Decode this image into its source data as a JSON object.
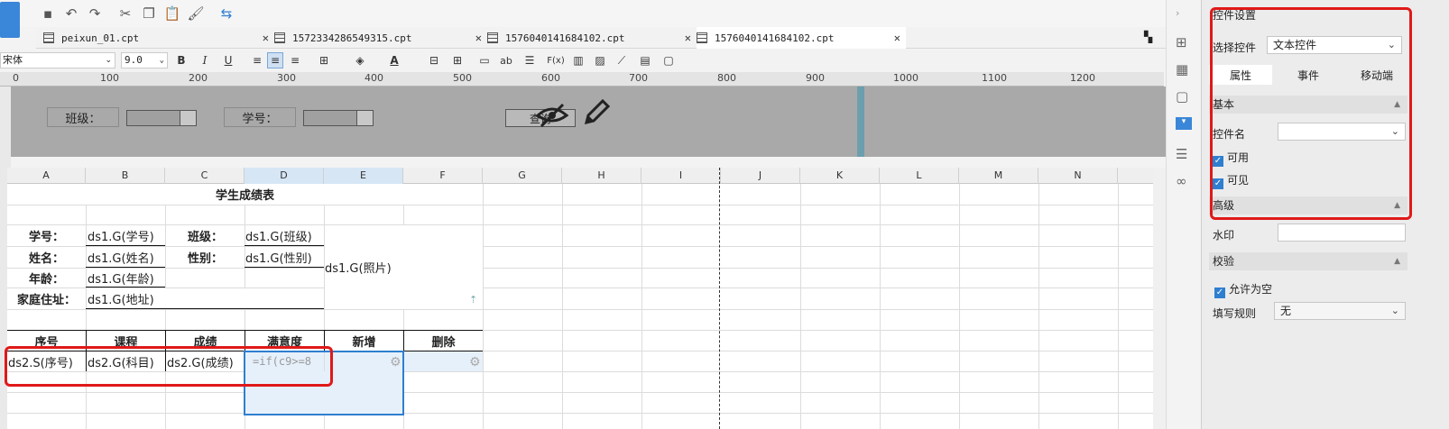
{
  "tabs": [
    {
      "label": "peixun_01.cpt"
    },
    {
      "label": "1572334286549315.cpt"
    },
    {
      "label": "1576040141684102.cpt"
    },
    {
      "label": "1576040141684102.cpt"
    }
  ],
  "format": {
    "font": "宋体",
    "size": "9.0",
    "bold": "B",
    "italic": "I",
    "underline": "U",
    "text_icon": "ab",
    "fx_icon": "F(x)"
  },
  "ruler": [
    "0",
    "100",
    "200",
    "300",
    "400",
    "500",
    "600",
    "700",
    "800",
    "900",
    "1000",
    "1100",
    "1200"
  ],
  "params": {
    "class_label": "班级：",
    "id_label": "学号：",
    "query_label": "查询"
  },
  "columns": [
    "A",
    "B",
    "C",
    "D",
    "E",
    "F",
    "G",
    "H",
    "I",
    "J",
    "K",
    "L",
    "M",
    "N"
  ],
  "sheet": {
    "title": "学生成绩表",
    "row1": {
      "id_label": "学号：",
      "id_val": "ds1.G(学号)",
      "class_label": "班级：",
      "class_val": "ds1.G(班级)"
    },
    "row2": {
      "name_label": "姓名：",
      "name_val": "ds1.G(姓名)",
      "sex_label": "性别：",
      "sex_val": "ds1.G(性别)",
      "photo": "ds1.G(照片)"
    },
    "row3": {
      "age_label": "年龄：",
      "age_val": "ds1.G(年龄)"
    },
    "row4": {
      "addr_label": "家庭住址：",
      "addr_val": "ds1.G(地址)"
    },
    "header": [
      "序号",
      "课程",
      "成绩",
      "满意度",
      "新增",
      "删除"
    ],
    "data": [
      "ds2.S(序号)",
      "ds2.G(科目)",
      "ds2.G(成绩)",
      "=if(c9>=8"
    ]
  },
  "panel": {
    "title": "控件设置",
    "select_label": "选择控件",
    "select_value": "文本控件",
    "tabs": [
      "属性",
      "事件",
      "移动端"
    ],
    "basic": "基本",
    "name_label": "控件名",
    "name_value": "",
    "enabled": "可用",
    "visible": "可见",
    "advanced": "高级",
    "watermark": "水印",
    "validate": "校验",
    "allow_empty": "允许为空",
    "rule_label": "填写规则",
    "rule_value": "无"
  }
}
